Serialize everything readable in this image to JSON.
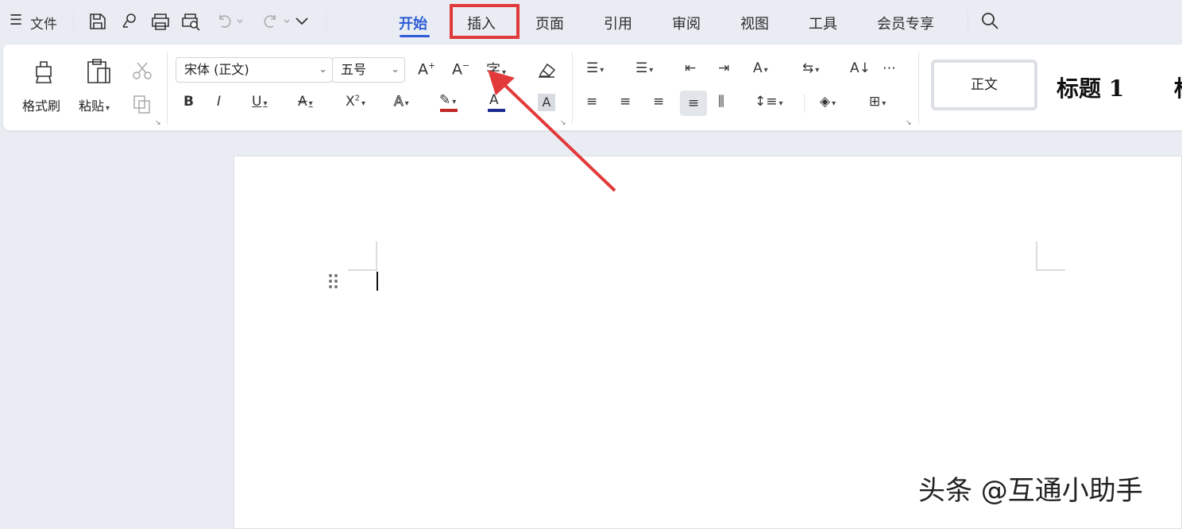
{
  "topbar": {
    "menu_label": "文件",
    "tabs": [
      "开始",
      "插入",
      "页面",
      "引用",
      "审阅",
      "视图",
      "工具",
      "会员专享"
    ]
  },
  "ribbon": {
    "format_painter": "格式刷",
    "paste": "粘贴",
    "font_name": "宋体 (正文)",
    "font_size": "五号",
    "styles": {
      "normal": "正文",
      "heading1": "标题 1",
      "heading2_partial": "标"
    }
  },
  "watermark": "头条 @互通小助手",
  "colors": {
    "accent": "#2f5cd6",
    "highlight_box": "#e23a3a",
    "arrow": "#e23a3a"
  }
}
